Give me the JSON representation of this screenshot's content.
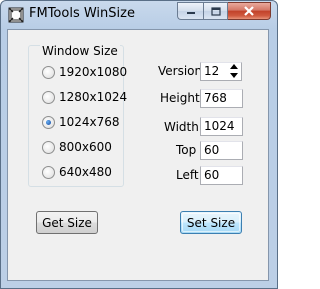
{
  "window": {
    "title": "FMTools WinSize"
  },
  "group": {
    "label": "Window Size",
    "options": [
      {
        "label": "1920x1080",
        "checked": false
      },
      {
        "label": "1280x1024",
        "checked": false
      },
      {
        "label": "1024x768",
        "checked": true
      },
      {
        "label": "800x600",
        "checked": false
      },
      {
        "label": "640x480",
        "checked": false
      }
    ]
  },
  "fields": {
    "version": {
      "label": "Version",
      "value": "12"
    },
    "height": {
      "label": "Height",
      "value": "768"
    },
    "width": {
      "label": "Width",
      "value": "1024"
    },
    "top": {
      "label": "Top",
      "value": "60"
    },
    "left": {
      "label": "Left",
      "value": "60"
    }
  },
  "buttons": {
    "get_size": "Get Size",
    "set_size": "Set Size"
  },
  "icons": {
    "app": "app-icon",
    "minimize": "minimize-icon",
    "maximize": "maximize-icon",
    "close": "close-icon",
    "spin_up": "up-arrow-icon",
    "spin_down": "down-arrow-icon"
  }
}
